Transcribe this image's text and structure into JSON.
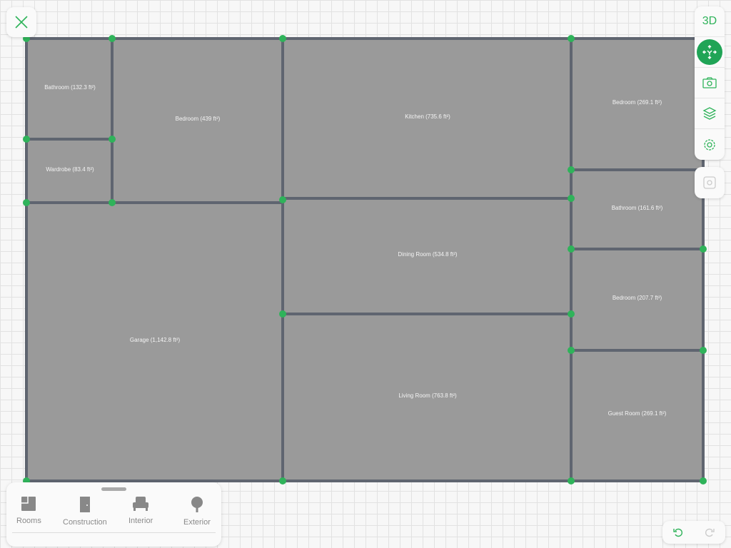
{
  "toolbar": {
    "view_3d": "3D",
    "icons": [
      "move-icon",
      "camera-icon",
      "layers-icon",
      "gear-icon"
    ],
    "accent": "#2fb35a"
  },
  "rooms": [
    {
      "label": "Bathroom (132.3 ft²)"
    },
    {
      "label": "Wardrobe (83.4 ft²)"
    },
    {
      "label": "Bedroom (439 ft²)"
    },
    {
      "label": "Garage (1,142.8 ft²)"
    },
    {
      "label": "Kitchen (735.6 ft²)"
    },
    {
      "label": "Dining Room (534.8 ft²)"
    },
    {
      "label": "Living Room (763.8 ft²)"
    },
    {
      "label": "Bedroom (269.1 ft²)"
    },
    {
      "label": "Bathroom (161.6 ft²)"
    },
    {
      "label": "Bedroom (207.7 ft²)"
    },
    {
      "label": "Guest Room (269.1 ft²)"
    }
  ],
  "panel": {
    "categories": [
      {
        "label": "Rooms"
      },
      {
        "label": "Construction"
      },
      {
        "label": "Interior"
      },
      {
        "label": "Exterior"
      }
    ]
  }
}
